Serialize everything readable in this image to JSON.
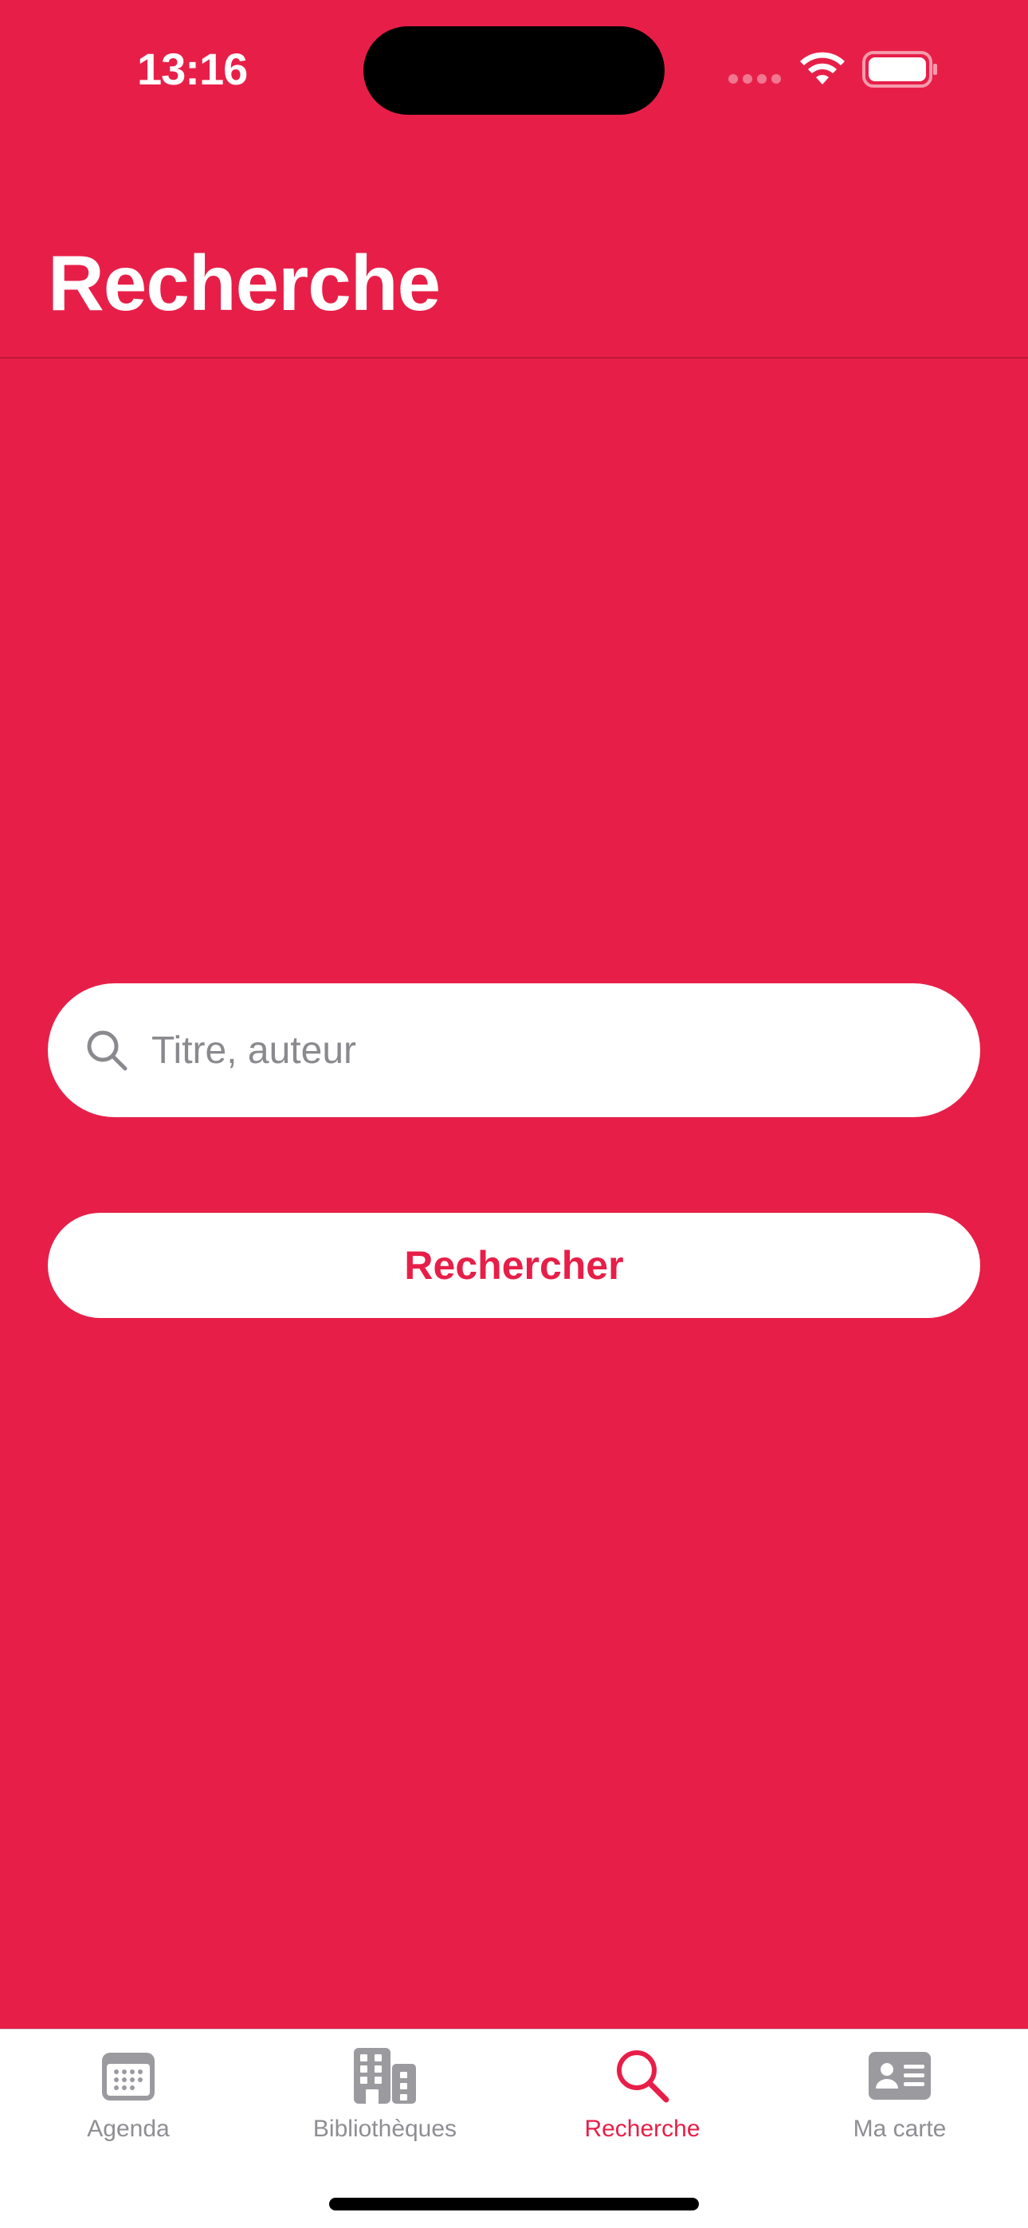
{
  "status_bar": {
    "time": "13:16",
    "icons": [
      "signal-icon",
      "wifi-icon",
      "battery-icon"
    ]
  },
  "header": {
    "title": "Recherche"
  },
  "search": {
    "placeholder": "Titre, auteur",
    "value": "",
    "icon": "search-icon"
  },
  "search_button": {
    "label": "Rechercher"
  },
  "tab_bar": {
    "tabs": [
      {
        "label": "Agenda",
        "icon": "calendar-icon",
        "active": false
      },
      {
        "label": "Bibliothèques",
        "icon": "buildings-icon",
        "active": false
      },
      {
        "label": "Recherche",
        "icon": "search-icon",
        "active": true
      },
      {
        "label": "Ma carte",
        "icon": "id-card-icon",
        "active": false
      }
    ]
  },
  "colors": {
    "accent": "#E71F48",
    "background": "#E71F48",
    "surface": "#FFFFFF",
    "inactive": "#8E8E93"
  }
}
